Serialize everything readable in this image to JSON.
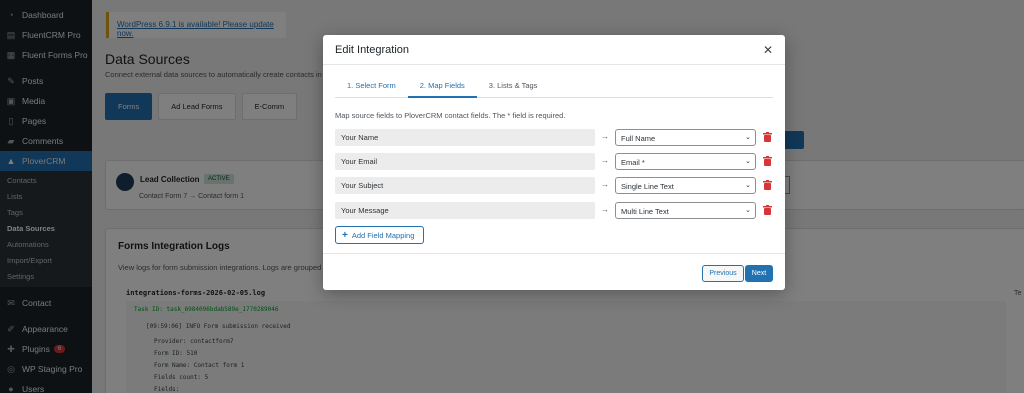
{
  "sidebar": {
    "items": [
      {
        "label": "Dashboard",
        "icon": "dashboard-icon"
      },
      {
        "label": "FluentCRM Pro",
        "icon": "fluentcrm-icon"
      },
      {
        "label": "Fluent Forms Pro",
        "icon": "fluentforms-icon"
      },
      {
        "label": "Posts",
        "icon": "pin-icon"
      },
      {
        "label": "Media",
        "icon": "media-icon"
      },
      {
        "label": "Pages",
        "icon": "pages-icon"
      },
      {
        "label": "Comments",
        "icon": "comments-icon"
      },
      {
        "label": "PloverCRM",
        "icon": "plovercrm-icon"
      }
    ],
    "submenu": [
      "Contacts",
      "Lists",
      "Tags",
      "Data Sources",
      "Automations",
      "Import/Export",
      "Settings"
    ],
    "items_after": [
      {
        "label": "Contact",
        "icon": "contact-icon"
      },
      {
        "label": "Appearance",
        "icon": "appearance-icon"
      },
      {
        "label": "Plugins",
        "icon": "plugins-icon",
        "badge": "6"
      },
      {
        "label": "WP Staging Pro",
        "icon": "wpstaging-icon"
      },
      {
        "label": "Users",
        "icon": "users-icon"
      }
    ]
  },
  "page": {
    "notice_text": "WordPress 6.9.1 is available! Please update now.",
    "title": "Data Sources",
    "description": "Connect external data sources to automatically create contacts in",
    "tabs": [
      "Forms",
      "Ad Lead Forms",
      "E-Comm"
    ],
    "lead_title": "Lead Collection",
    "lead_status": "ACTIVE",
    "lead_sub": "Contact Form 7 → Contact form 1",
    "logs_title": "Forms Integration Logs",
    "logs_desc": "View logs for form submission integrations. Logs are grouped",
    "log_file": "integrations-forms-2026-02-05.log",
    "log_task": "Task ID: task_6984096bdab589e_1770289046",
    "log_lines": [
      "[09:59:06] INFO Form submission received",
      "Provider: contactform7",
      "Form ID: 510",
      "Form Name: Contact form 1",
      "Fields count: 5",
      "Fields:"
    ],
    "right_te": "Te"
  },
  "modal": {
    "title": "Edit Integration",
    "tabs": [
      "1. Select Form",
      "2. Map Fields",
      "3. Lists & Tags"
    ],
    "description": "Map source fields to PloverCRM contact fields. The * field is required.",
    "mappings": [
      {
        "source": "Your Name",
        "target": "Full Name"
      },
      {
        "source": "Your Email",
        "target": "Email *"
      },
      {
        "source": "Your Subject",
        "target": "Single Line Text"
      },
      {
        "source": "Your Message",
        "target": "Multi Line Text"
      }
    ],
    "arrow": "→",
    "add_label": "Add Field Mapping",
    "prev_label": "Previous",
    "next_label": "Next"
  },
  "colors": {
    "accent": "#2271b1",
    "danger": "#d63638",
    "sidebar": "#1d2327"
  }
}
